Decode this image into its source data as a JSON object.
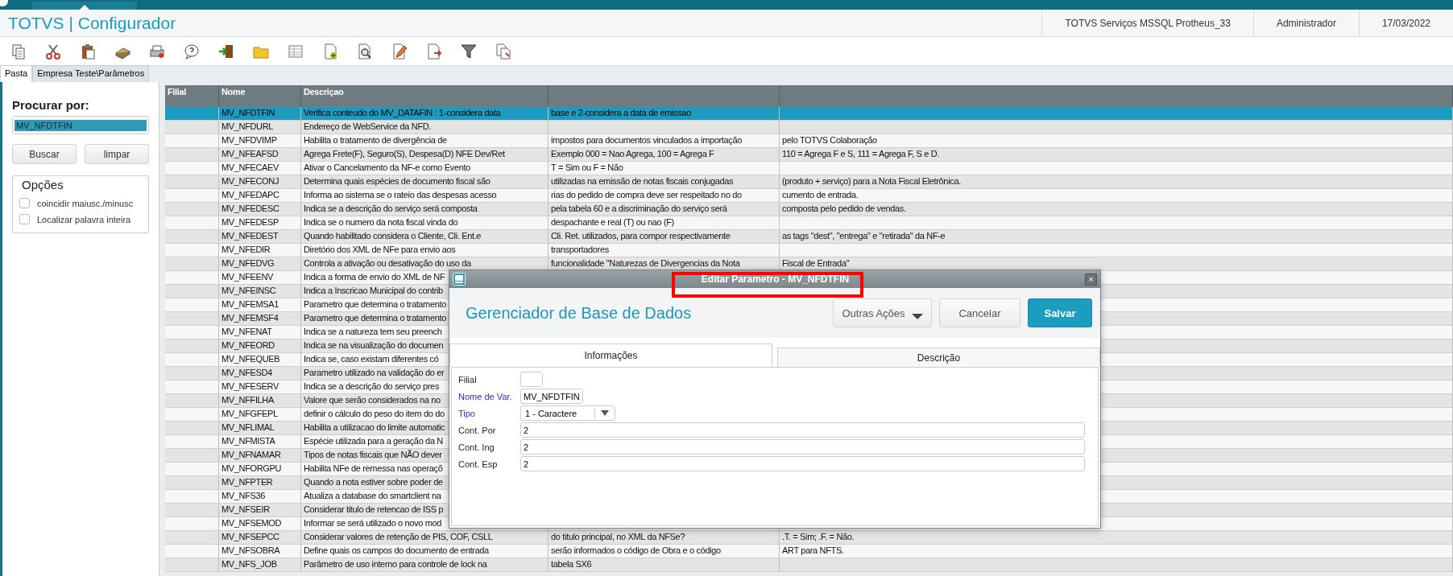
{
  "header": {
    "title": "TOTVS | Configurador",
    "environment": "TOTVS Serviços MSSQL Protheus_33",
    "user": "Administrador",
    "date": "17/03/2022"
  },
  "tabs": [
    {
      "label": "Pasta",
      "selected": true
    },
    {
      "label": "Empresa Teste\\Parâmetros",
      "selected": false
    }
  ],
  "search": {
    "label": "Procurar por:",
    "value": "MV_NFDTFIN",
    "value_selected": true,
    "buttons": [
      "Buscar",
      "limpar"
    ]
  },
  "options": {
    "title": "Opções",
    "items": [
      {
        "label": "coincidir maiusc./minusc",
        "checked": false
      },
      {
        "label": "Localizar palavra inteira",
        "checked": false
      }
    ]
  },
  "table": {
    "columns": [
      "Filial",
      "Nome",
      "Descriçao"
    ],
    "rows": [
      {
        "name": "MV_NFDTFIN",
        "description": "Verifica conteudo do MV_DATAFIN : 1-considera data",
        "column_4": "base e 2-considera a data de emissao",
        "selected": true
      },
      {
        "name": "MV_NFDURL",
        "description": "Endereço de WebService da NFD.",
        "selected": false
      },
      {
        "name": "MV_NFDVIMP",
        "description": "Habilita o tratamento de divergência de",
        "column_4": "impostos para documentos vinculados a importação",
        "column_5": "pelo TOTVS Colaboração",
        "selected": false
      },
      {
        "name": "MV_NFEAFSD",
        "description": "Agrega Frete(F), Seguro(S), Despesa(D) NFE Dev/Ret",
        "column_4": "Exemplo 000 = Nao Agrega, 100 = Agrega F",
        "column_5": "110 = Agrega F e S, 111 = Agrega F, S e D.",
        "selected": false
      },
      {
        "name": "MV_NFECAEV",
        "description": "Ativar o Cancelamento da NF-e como Evento",
        "column_4": "T = Sim ou F = Não",
        "selected": false
      },
      {
        "name": "MV_NFECONJ",
        "description": "Determina quais espécies de documento fiscal são",
        "column_4": "utilizadas na emissão de notas fiscais conjugadas",
        "column_5": "(produto + serviço) para a Nota Fiscal Eletrônica.",
        "selected": false
      },
      {
        "name": "MV_NFEDAPC",
        "description": "Informa ao sistema se o rateio das despesas acesso",
        "column_4": "rias do pedido de compra deve ser respeitado no do",
        "column_5": "cumento de entrada.",
        "selected": false
      },
      {
        "name": "MV_NFEDESC",
        "description": "Indica se a descrição do serviço será composta",
        "column_4": "pela tabela 60 e a discriminação do serviço será",
        "column_5": "composta pelo pedido de vendas.",
        "selected": false
      },
      {
        "name": "MV_NFEDESP",
        "description": "Indica se o numero da nota fiscal vinda do",
        "column_4": "despachante e real (T) ou nao (F)",
        "selected": false
      },
      {
        "name": "MV_NFEDEST",
        "description": "Quando habilitado considera o Cliente, Cli. Ent.e",
        "column_4": "Cli. Ret. utilizados, para compor respectivamente",
        "column_5": "as tags \"dest\", \"entrega\" e \"retirada\" da NF-e",
        "selected": false
      },
      {
        "name": "MV_NFEDIR",
        "description": "Diretório dos XML de NFe para envio aos",
        "column_4": "transportadores",
        "selected": false
      },
      {
        "name": "MV_NFEDVG",
        "description": "Controla a ativação ou desativação do uso da",
        "column_4": "funcionalidade \"Naturezas de Divergencias da Nota",
        "column_5": "Fiscal de Entrada\"",
        "selected": false
      },
      {
        "name": "MV_NFEENV",
        "description": "Indica a forma de envio do XML de NF",
        "selected": false
      },
      {
        "name": "MV_NFEINSC",
        "description": "Indica a Inscricao Municipal do contrib",
        "selected": false
      },
      {
        "name": "MV_NFEMSA1",
        "description": "Parametro que determina o tratamento",
        "selected": false
      },
      {
        "name": "MV_NFEMSF4",
        "description": "Parametro que determina o tratamento",
        "selected": false
      },
      {
        "name": "MV_NFENAT",
        "description": "Indica se a natureza tem seu preench",
        "selected": false
      },
      {
        "name": "MV_NFEORD",
        "description": "Indica se na visualização do documen",
        "selected": false
      },
      {
        "name": "MV_NFEQUEB",
        "description": "Indica se, caso existam diferentes có",
        "selected": false
      },
      {
        "name": "MV_NFESD4",
        "description": "Parametro utilizado na validação do er",
        "selected": false
      },
      {
        "name": "MV_NFESERV",
        "description": "Indica se a descrição do serviço pres",
        "selected": false
      },
      {
        "name": "MV_NFFILHA",
        "description": "Valore que serão considerados na no",
        "selected": false
      },
      {
        "name": "MV_NFGFEPL",
        "description": "definir o cálculo do peso do item do do",
        "selected": false
      },
      {
        "name": "MV_NFLIMAL",
        "description": "Habilita a utilizacao do limite automatic",
        "selected": false
      },
      {
        "name": "MV_NFMISTA",
        "description": "Espécie utilizada para a geração da N",
        "selected": false
      },
      {
        "name": "MV_NFNAMAR",
        "description": "Tipos de notas fiscais que NÃO dever",
        "selected": false
      },
      {
        "name": "MV_NFORGPU",
        "description": "Habilita NFe de remessa nas operaçõ",
        "selected": false
      },
      {
        "name": "MV_NFPTER",
        "description": "Quando a nota estiver sobre poder de",
        "selected": false
      },
      {
        "name": "MV_NFS36",
        "description": "Atualiza a database do smartclient na",
        "selected": false
      },
      {
        "name": "MV_NFSEIR",
        "description": "Considerar titulo de retencao de ISS p",
        "selected": false
      },
      {
        "name": "MV_NFSEMOD",
        "description": "Informar se será utilizado o novo mod",
        "selected": false
      },
      {
        "name": "MV_NFSEPCC",
        "description": "Considerar valores de retenção de PIS, COF, CSLL",
        "column_4": "do titulo principal, no XML da NFSe?",
        "column_5": ".T. = Sim; .F. = Não.",
        "selected": false
      },
      {
        "name": "MV_NFSOBRA",
        "description": "Define quais os campos do documento de entrada",
        "column_4": "serão informados o código de Obra e o código",
        "column_5": "ART para NFTS.",
        "selected": false
      },
      {
        "name": "MV_NFS_JOB",
        "description": "Parâmetro de uso interno para controle de lock na",
        "column_4": "tabela SX6",
        "selected": false
      }
    ]
  },
  "dialog": {
    "title": "Editar Parametro - MV_NFDTFIN",
    "close": "×",
    "heading": "Gerenciador de Base de Dados",
    "buttons": [
      {
        "label": "Outras Ações",
        "kind": "menu"
      },
      {
        "label": "Cancelar",
        "kind": "plain"
      },
      {
        "label": "Salvar",
        "kind": "primary"
      }
    ],
    "tabs": [
      {
        "label": "Informações",
        "selected": true
      },
      {
        "label": "Descrição",
        "selected": false
      }
    ],
    "fields": [
      {
        "label": "Filial",
        "required": false,
        "kind": "short"
      },
      {
        "label": "Nome de Var.",
        "required": true,
        "kind": "medium",
        "value": "MV_NFDTFIN"
      },
      {
        "label": "Tipo",
        "required": true,
        "kind": "select",
        "value": "1 - Caractere"
      },
      {
        "label": "Cont. Por",
        "required": false,
        "kind": "wide",
        "value": "2"
      },
      {
        "label": "Cont. Ing",
        "required": false,
        "kind": "wide",
        "value": "2"
      },
      {
        "label": "Cont. Esp",
        "required": false,
        "kind": "wide",
        "value": "2"
      }
    ]
  }
}
